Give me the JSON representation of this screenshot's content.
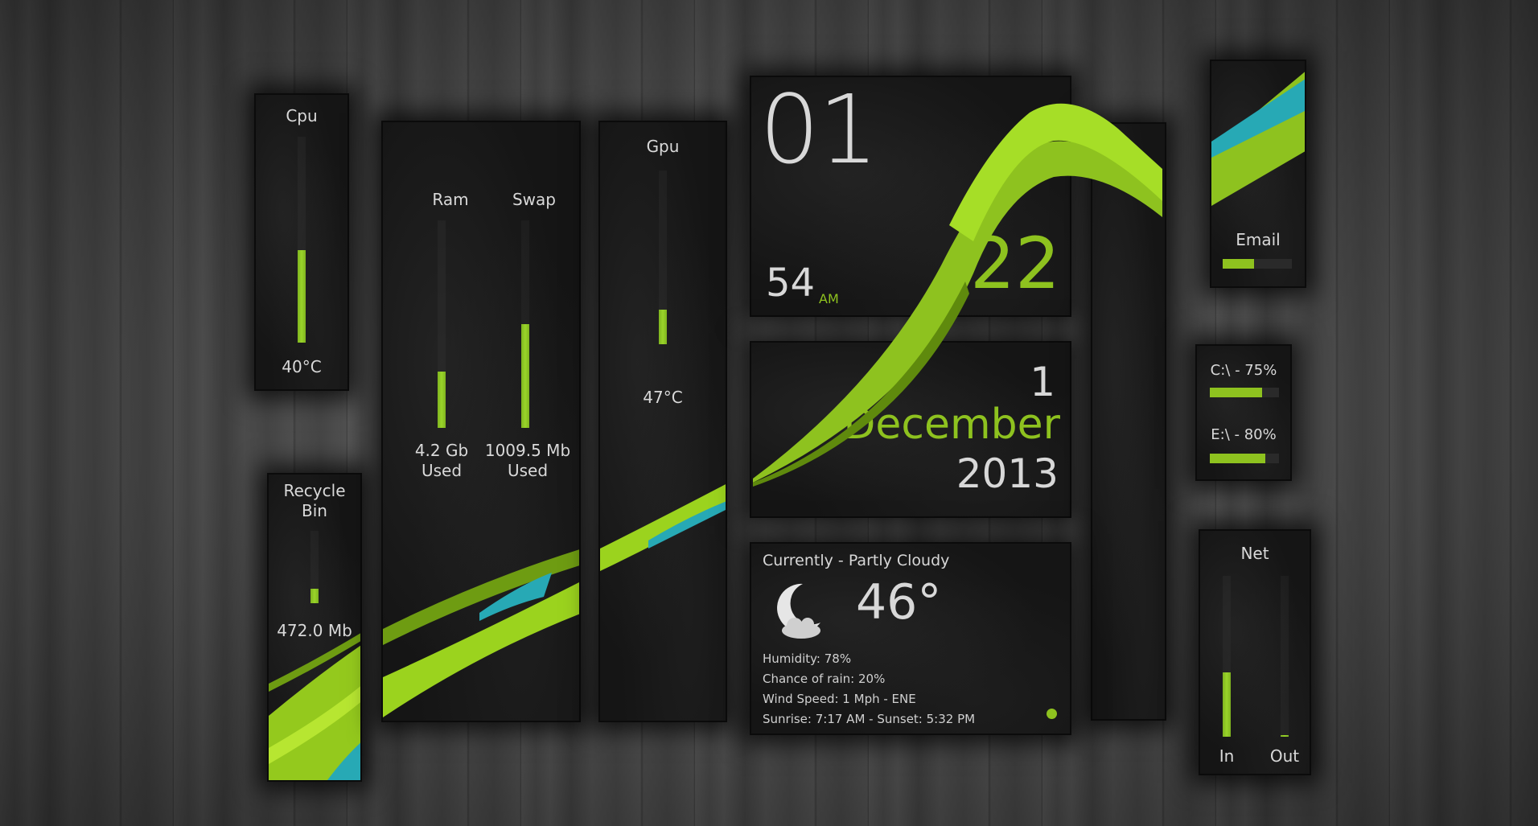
{
  "cpu": {
    "label": "Cpu",
    "temp": "40°C",
    "level": 0.45
  },
  "recycle": {
    "label_line1": "Recycle",
    "label_line2": "Bin",
    "size": "472.0 Mb",
    "level": 0.2
  },
  "memory": {
    "ram": {
      "label": "Ram",
      "value": "4.2 Gb",
      "sub": "Used",
      "level": 0.27
    },
    "swap": {
      "label": "Swap",
      "value": "1009.5 Mb",
      "sub": "Used",
      "level": 0.5
    }
  },
  "gpu": {
    "label": "Gpu",
    "temp": "47°C",
    "level": 0.2
  },
  "clock": {
    "hour": "01",
    "minutes": "22",
    "seconds": "54",
    "ampm": "AM"
  },
  "date": {
    "day": "1",
    "month": "December",
    "year": "2013"
  },
  "weather": {
    "title": "Currently - Partly Cloudy",
    "temperature": "46°",
    "icon": "moon-cloud-icon",
    "humidity": "Humidity: 78%",
    "rain": "Chance of rain: 20%",
    "wind": "Wind Speed: 1 Mph - ENE",
    "sun": "Sunrise: 7:17 AM - Sunset: 5:32 PM"
  },
  "email": {
    "label": "Email",
    "level": 0.45
  },
  "drives": [
    {
      "label": "C:\\ - 75%",
      "level": 0.75
    },
    {
      "label": "E:\\ - 80%",
      "level": 0.8
    }
  ],
  "net": {
    "label": "Net",
    "in_label": "In",
    "out_label": "Out",
    "in_level": 0.4,
    "out_level": 0.01
  },
  "colors": {
    "accent": "#8ec21f",
    "teal": "#27a9b5",
    "text": "#d9d9d9"
  }
}
